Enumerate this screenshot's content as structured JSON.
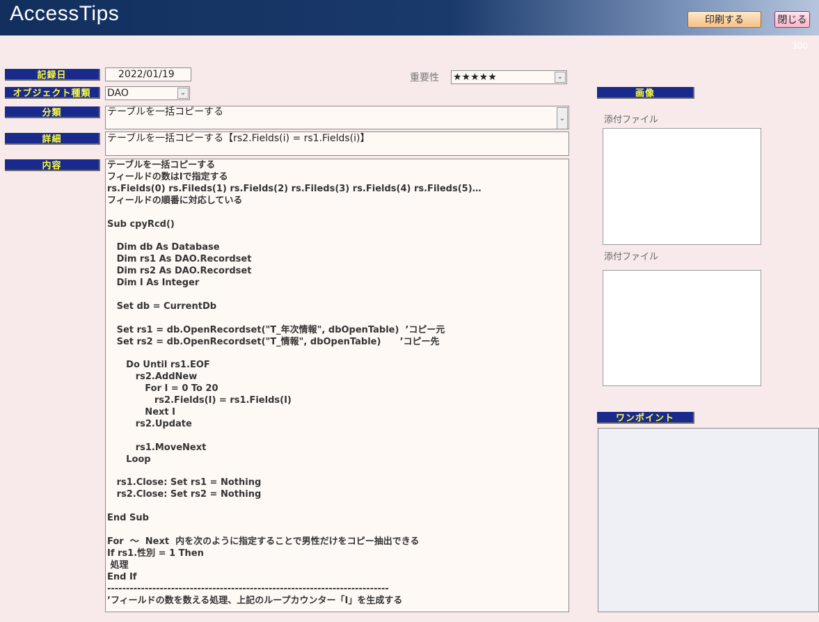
{
  "app": {
    "title": "AccessTips",
    "record_number": "300"
  },
  "toolbar": {
    "print_label": "印刷する",
    "close_label": "閉じる"
  },
  "labels": {
    "record_date": "記録日",
    "object_type": "オブジェクト種類",
    "category": "分類",
    "detail": "詳細",
    "content": "内容",
    "image": "画像",
    "one_point": "ワンポイント"
  },
  "fields": {
    "record_date": "2022/01/19",
    "importance_label": "重要性",
    "importance": "★★★★★",
    "object_type": "DAO",
    "category": "テーブルを一括コピーする",
    "detail": "テーブルを一括コピーする【rs2.Fields(i) = rs1.Fields(i)】",
    "content": "テーブルを一括コピーする\nフィールドの数はIで指定する\nrs.Fields(0) rs.Fileds(1) rs.Fields(2) rs.Fileds(3) rs.Fields(4) rs.Fileds(5)…\nフィールドの順番に対応している\n\nSub cpyRcd()\n\n   Dim db As Database\n   Dim rs1 As DAO.Recordset\n   Dim rs2 As DAO.Recordset\n   Dim I As Integer\n\n   Set db = CurrentDb\n\n   Set rs1 = db.OpenRecordset(\"T_年次情報\", dbOpenTable)  ’コピー元\n   Set rs2 = db.OpenRecordset(\"T_情報\", dbOpenTable)      ’コピー先\n\n      Do Until rs1.EOF\n         rs2.AddNew\n            For I = 0 To 20\n               rs2.Fields(I) = rs1.Fields(I)\n            Next I\n         rs2.Update\n\n         rs1.MoveNext\n      Loop\n\n   rs1.Close: Set rs1 = Nothing\n   rs2.Close: Set rs2 = Nothing\n\nEnd Sub\n\nFor  ～  Next  内を次のように指定することで男性だけをコピー抽出できる\nIf rs1.性別 = 1 Then\n 処理\nEnd If\n---------------------------------------------------------------------------\n’フィールドの数を数える処理、上記のループカウンター「I」を生成する",
    "attachment1_label": "添付ファイル",
    "attachment2_label": "添付ファイル"
  },
  "icons": {
    "dropdown": "chevron-down-icon"
  },
  "colors": {
    "label_bg": "#1a2a8c",
    "label_text": "#ffff3c",
    "header_dark": "#122f5d"
  }
}
